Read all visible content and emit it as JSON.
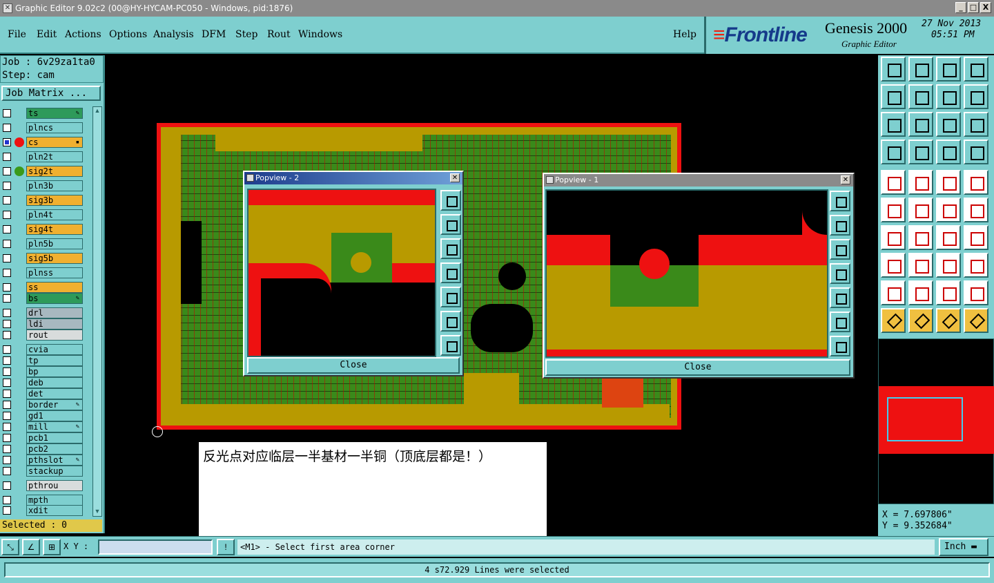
{
  "window": {
    "title": "Graphic Editor 9.02c2 (00@HY-HYCAM-PC050 - Windows, pid:1876)",
    "controls": [
      "_",
      "□",
      "X"
    ]
  },
  "menu": {
    "file": "File",
    "edit": "Edit",
    "actions": "Actions",
    "options": "Options",
    "analysis": "Analysis",
    "dfm": "DFM",
    "step": "Step",
    "rout": "Rout",
    "windows": "Windows",
    "help": "Help"
  },
  "brand": {
    "logo_stripes": "≡",
    "logo_text": "Frontline",
    "product": "Genesis 2000",
    "subtitle": "Graphic Editor",
    "date": "27 Nov 2013",
    "time": "05:51 PM"
  },
  "job": {
    "job_line": "Job : 6v29za1ta0",
    "step_line": "Step: cam",
    "matrix_button": "Job Matrix ..."
  },
  "layers": [
    {
      "name": "ts",
      "color": "#2e9a5a",
      "checked": false,
      "dot": null,
      "mark": "✎"
    },
    {
      "name": "plncs",
      "color": "#7ecfcf",
      "checked": false,
      "dot": null,
      "mark": ""
    },
    {
      "name": "cs",
      "color": "#f0b030",
      "checked": true,
      "dot": "#e11",
      "mark": "▪"
    },
    {
      "name": "pln2t",
      "color": "#7ecfcf",
      "checked": false,
      "dot": null,
      "mark": ""
    },
    {
      "name": "sig2t",
      "color": "#f0b030",
      "checked": false,
      "dot": "#3a9a1a",
      "mark": ""
    },
    {
      "name": "pln3b",
      "color": "#7ecfcf",
      "checked": false,
      "dot": null,
      "mark": ""
    },
    {
      "name": "sig3b",
      "color": "#f0b030",
      "checked": false,
      "dot": null,
      "mark": ""
    },
    {
      "name": "pln4t",
      "color": "#7ecfcf",
      "checked": false,
      "dot": null,
      "mark": ""
    },
    {
      "name": "sig4t",
      "color": "#f0b030",
      "checked": false,
      "dot": null,
      "mark": ""
    },
    {
      "name": "pln5b",
      "color": "#7ecfcf",
      "checked": false,
      "dot": null,
      "mark": ""
    },
    {
      "name": "sig5b",
      "color": "#f0b030",
      "checked": false,
      "dot": null,
      "mark": ""
    },
    {
      "name": "plnss",
      "color": "#7ecfcf",
      "checked": false,
      "dot": null,
      "mark": ""
    },
    {
      "name": "ss",
      "color": "#f0b030",
      "checked": false,
      "dot": null,
      "mark": ""
    },
    {
      "name": "bs",
      "color": "#2e9a5a",
      "checked": false,
      "dot": null,
      "mark": "✎"
    },
    {
      "name": "drl",
      "color": "#a8b8c0",
      "checked": false,
      "dot": null,
      "mark": ""
    },
    {
      "name": "ldi",
      "color": "#a8b8c0",
      "checked": false,
      "dot": null,
      "mark": ""
    },
    {
      "name": "rout",
      "color": "#d8dcdc",
      "checked": false,
      "dot": null,
      "mark": ""
    },
    {
      "name": "cvia",
      "color": "#7ecfcf",
      "checked": false,
      "dot": null,
      "mark": ""
    },
    {
      "name": "tp",
      "color": "#7ecfcf",
      "checked": false,
      "dot": null,
      "mark": ""
    },
    {
      "name": "bp",
      "color": "#7ecfcf",
      "checked": false,
      "dot": null,
      "mark": ""
    },
    {
      "name": "deb",
      "color": "#7ecfcf",
      "checked": false,
      "dot": null,
      "mark": ""
    },
    {
      "name": "det",
      "color": "#7ecfcf",
      "checked": false,
      "dot": null,
      "mark": ""
    },
    {
      "name": "border",
      "color": "#7ecfcf",
      "checked": false,
      "dot": null,
      "mark": "✎"
    },
    {
      "name": "gd1",
      "color": "#7ecfcf",
      "checked": false,
      "dot": null,
      "mark": ""
    },
    {
      "name": "mill",
      "color": "#7ecfcf",
      "checked": false,
      "dot": null,
      "mark": "✎"
    },
    {
      "name": "pcb1",
      "color": "#7ecfcf",
      "checked": false,
      "dot": null,
      "mark": ""
    },
    {
      "name": "pcb2",
      "color": "#7ecfcf",
      "checked": false,
      "dot": null,
      "mark": ""
    },
    {
      "name": "pthslot",
      "color": "#7ecfcf",
      "checked": false,
      "dot": null,
      "mark": "✎"
    },
    {
      "name": "stackup",
      "color": "#7ecfcf",
      "checked": false,
      "dot": null,
      "mark": ""
    },
    {
      "name": "pthrou",
      "color": "#d8dcdc",
      "checked": false,
      "dot": null,
      "mark": ""
    },
    {
      "name": "mpth",
      "color": "#7ecfcf",
      "checked": false,
      "dot": null,
      "mark": ""
    },
    {
      "name": "xdit",
      "color": "#7ecfcf",
      "checked": false,
      "dot": null,
      "mark": ""
    }
  ],
  "selected_text": "Selected : 0",
  "annotation": "反光点对应临层一半基材一半铜（顶底层都是！）",
  "popview2": {
    "title": "Popview - 2",
    "close_label": "Close"
  },
  "popview1": {
    "title": "Popview - 1",
    "close_label": "Close"
  },
  "coords": {
    "x": "X = 7.697806\"",
    "y": "Y = 9.352684\""
  },
  "bottom": {
    "xy_label": "X Y :",
    "xy_value": "",
    "prompt": "<M1> - Select first area corner",
    "units": "Inch",
    "status": "4 s72.929 Lines were selected"
  },
  "colors": {
    "panel": "#7ecfcf",
    "copper": "#b89a00",
    "copper_red": "#e11",
    "green": "#3a8a1a"
  }
}
